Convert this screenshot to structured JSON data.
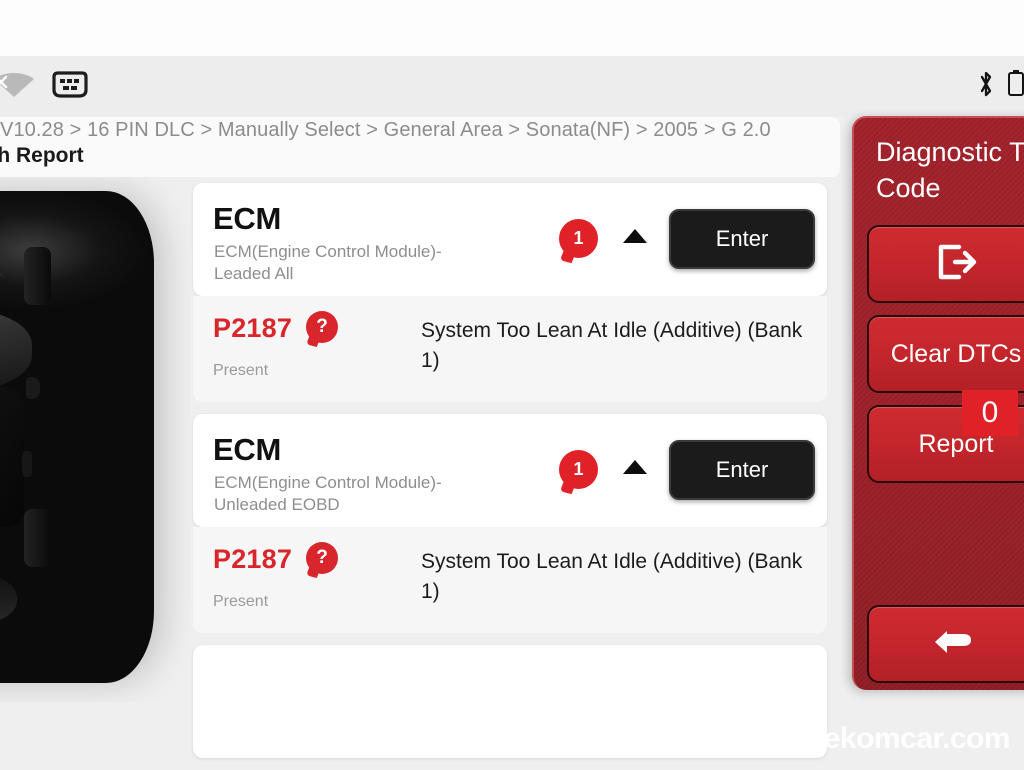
{
  "status_bar": {
    "icons_left": [
      {
        "name": "wifi-off-icon",
        "label": "wifi-off"
      },
      {
        "name": "obd-connector-icon",
        "label": "obd-dlc-connector"
      }
    ],
    "icons_right": [
      {
        "name": "bluetooth-icon",
        "label": "bluetooth"
      },
      {
        "name": "battery-icon",
        "label": "battery"
      }
    ]
  },
  "header": {
    "breadcrumb": "V10.28 > 16 PIN DLC > Manually Select > General Area > Sonata(NF) > 2005 > G 2.0",
    "title": "Health Report"
  },
  "vehicle_image": {
    "name": "vehicle-top-view",
    "description": "black sedan top view"
  },
  "modules": [
    {
      "name": "ECM",
      "description": "ECM(Engine Control Module)-Leaded All",
      "fault_count": "1",
      "enter_label": "Enter",
      "expanded": true,
      "dtcs": [
        {
          "code": "P2187",
          "help": "?",
          "status": "Present",
          "description": "System Too Lean At Idle (Additive) (Bank 1)"
        }
      ]
    },
    {
      "name": "ECM",
      "description": "ECM(Engine Control Module)-Unleaded EOBD",
      "fault_count": "1",
      "enter_label": "Enter",
      "expanded": true,
      "dtcs": [
        {
          "code": "P2187",
          "help": "?",
          "status": "Present",
          "description": "System Too Lean At Idle (Additive) (Bank 1)"
        }
      ]
    }
  ],
  "toolbar": {
    "title": "Diagnostic Trouble Code",
    "exit_label": "",
    "clear_dtc_label": "Clear DTCs",
    "report_label": "Report",
    "report_count": "0",
    "back_label": ""
  },
  "watermark": "bekomcar.com",
  "colors": {
    "accent_red": "#d8262c",
    "panel_red": "#9b2028",
    "button_red": "#c3262c",
    "badge_red": "#e02127",
    "page_bg": "#efefef",
    "card_bg": "#ffffff"
  }
}
